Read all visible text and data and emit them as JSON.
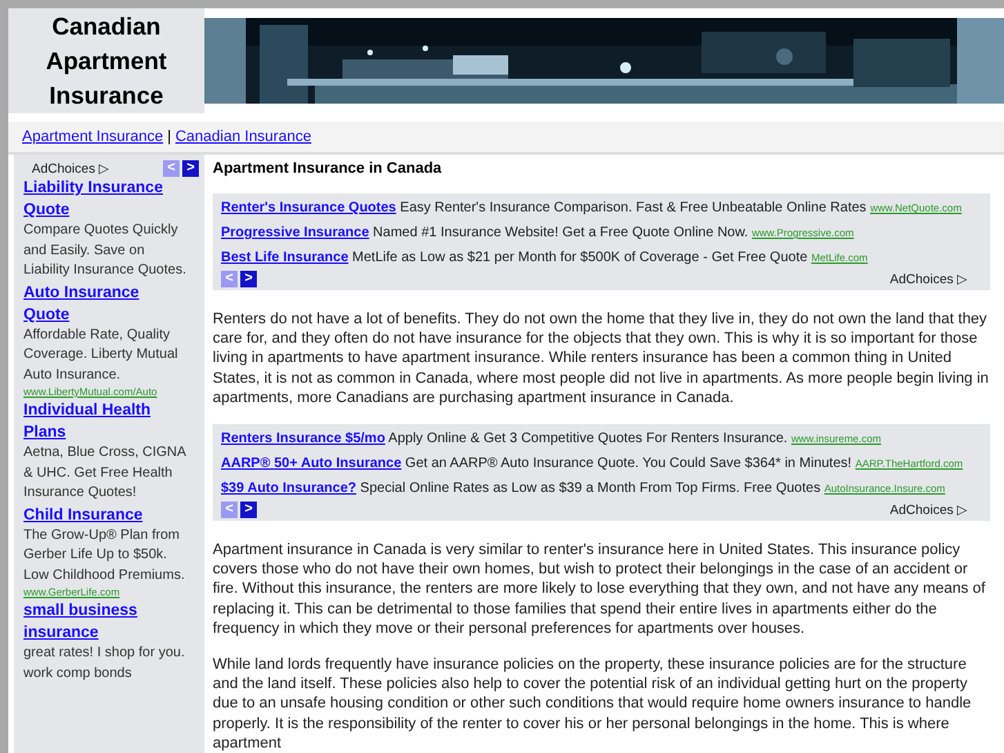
{
  "header": {
    "title": "Canadian Apartment Insurance"
  },
  "nav": {
    "links": [
      "Apartment Insurance",
      "Canadian Insurance"
    ],
    "separator": "|"
  },
  "sidebar": {
    "adchoices": "AdChoices ▷",
    "pager": [
      {
        "symbol": "<",
        "disabled": true
      },
      {
        "symbol": ">",
        "disabled": false
      }
    ],
    "ads": [
      {
        "title": "Liability Insurance Quote",
        "text": "Compare Quotes Quickly and Easily. Save on Liability Insurance Quotes."
      },
      {
        "title": "Auto Insurance Quote",
        "text": "Affordable Rate, Quality Coverage. Liberty Mutual Auto Insurance.",
        "url": "www.LibertyMutual.com/Auto"
      },
      {
        "title": "Individual Health Plans",
        "text": "Aetna, Blue Cross, CIGNA & UHC. Get Free Health Insurance Quotes!"
      },
      {
        "title": "Child Insurance",
        "text": "The Grow-Up® Plan from Gerber Life Up to $50k. Low Childhood Premiums.",
        "url": "www.GerberLife.com"
      },
      {
        "title": "small business insurance",
        "text": "great rates! I shop for you. work comp bonds"
      }
    ]
  },
  "main": {
    "heading": "Apartment Insurance in Canada",
    "blocks": [
      {
        "kind": "ads",
        "adchoices": "AdChoices ▷",
        "pager": [
          {
            "symbol": "<",
            "disabled": true
          },
          {
            "symbol": ">",
            "disabled": false
          }
        ],
        "ads": [
          {
            "title": "Renter's Insurance Quotes",
            "text": "Easy Renter's Insurance Comparison. Fast & Free Unbeatable Online Rates",
            "url": "www.NetQuote.com"
          },
          {
            "title": "Progressive Insurance",
            "text": "Named #1 Insurance Website! Get a Free Quote Online Now.",
            "url": "www.Progressive.com"
          },
          {
            "title": "Best Life Insurance",
            "text": "MetLife as Low as $21 per Month for $500K of Coverage - Get Free Quote",
            "url": "MetLife.com"
          }
        ]
      },
      {
        "kind": "paragraph",
        "text": "Renters do not have a lot of benefits. They do not own the home that they live in, they do not own the land that they care for, and they often do not have insurance for the objects that they own. This is why it is so important for those living in apartments to have apartment insurance. While renters insurance has been a common thing in United States, it is not as common in Canada, where most people did not live in apartments. As more people begin living in apartments, more Canadians are purchasing apartment insurance in Canada."
      },
      {
        "kind": "ads",
        "adchoices": "AdChoices ▷",
        "pager": [
          {
            "symbol": "<",
            "disabled": true
          },
          {
            "symbol": ">",
            "disabled": false
          }
        ],
        "ads": [
          {
            "title": "Renters Insurance $5/mo",
            "text": "Apply Online & Get 3 Competitive Quotes For Renters Insurance.",
            "url": "www.insureme.com"
          },
          {
            "title": "AARP® 50+ Auto Insurance",
            "text": "Get an AARP® Auto Insurance Quote. You Could Save $364* in Minutes!",
            "url": "AARP.TheHartford.com"
          },
          {
            "title": "$39 Auto Insurance?",
            "text": "Special Online Rates as Low as $39 a Month From Top Firms. Free Quotes",
            "url": "AutoInsurance.Insure.com"
          }
        ]
      },
      {
        "kind": "paragraph",
        "text": "Apartment insurance in Canada is very similar to renter's insurance here in United States. This insurance policy covers those who do not have their own homes, but wish to protect their belongings in the case of an accident or fire. Without this insurance, the renters are more likely to lose everything that they own, and not have any means of replacing it. This can be detrimental to those families that spend their entire lives in apartments either do the frequency in which they move or their personal preferences for apartments over houses."
      },
      {
        "kind": "paragraph",
        "text": "While land lords frequently have insurance policies on the property, these insurance policies are for the structure and the land itself. These policies also help to cover the potential risk of an individual getting hurt on the property due to an unsafe housing condition or other such conditions that would require home owners insurance to handle properly. It is the responsibility of the renter to cover his or her personal belongings in the home. This is where apartment"
      }
    ]
  }
}
